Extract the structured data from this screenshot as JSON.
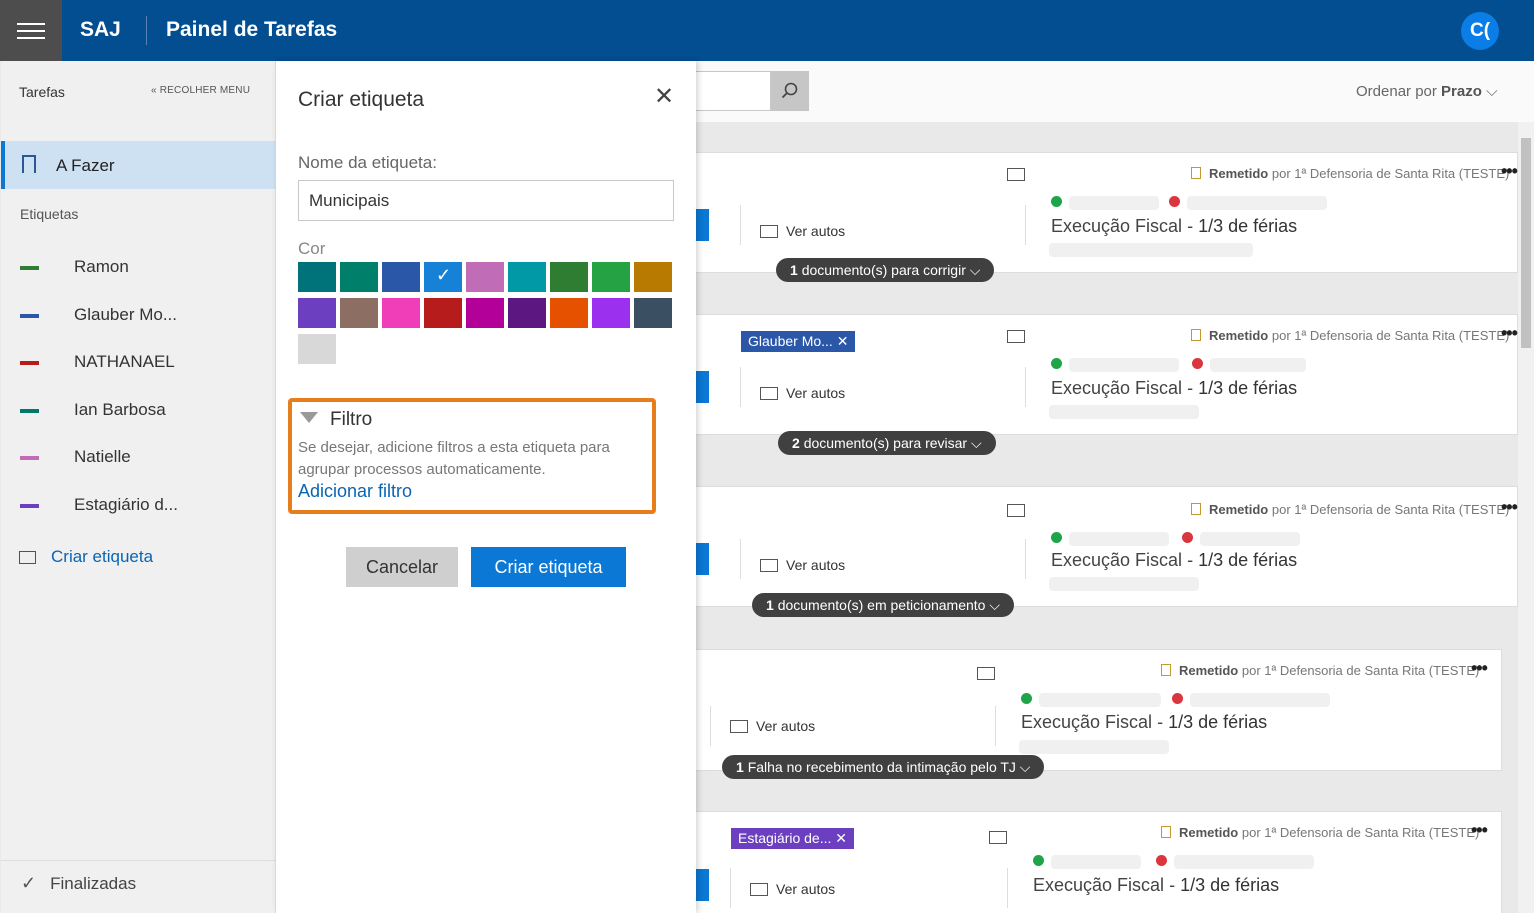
{
  "header": {
    "brand": "SAJ",
    "title": "Painel de Tarefas",
    "avatar": "C("
  },
  "sidebar": {
    "title": "Tarefas",
    "collapse": "RECOLHER MENU",
    "active_item": "A Fazer",
    "section": "Etiquetas",
    "tags": [
      {
        "label": "Ramon",
        "color": "#2e7d32"
      },
      {
        "label": "Glauber Mo...",
        "color": "#2b5797"
      },
      {
        "label": "NATHANAEL",
        "color": "#b71c1c"
      },
      {
        "label": "Ian Barbosa",
        "color": "#00796b"
      },
      {
        "label": "Natielle",
        "color": "#c36cb6"
      },
      {
        "label": "Estagiário d...",
        "color": "#6b3fc0"
      }
    ],
    "create_tag": "Criar etiqueta",
    "finalized": "Finalizadas"
  },
  "toolbar": {
    "order_label": "Ordenar por",
    "order_value": "Prazo"
  },
  "cards": [
    {
      "remetido": "Remetido",
      "by": "por 1ª Defensoria de Santa Rita (TESTE)",
      "ver_autos": "Ver autos",
      "exec": "Execução Fiscal",
      "exec_suffix": "1/3 de férias",
      "pill_count": "1",
      "pill_text": "documento(s) para corrigir",
      "tag": ""
    },
    {
      "remetido": "Remetido",
      "by": "por 1ª Defensoria de Santa Rita (TESTE)",
      "ver_autos": "Ver autos",
      "exec": "Execução Fiscal",
      "exec_suffix": "1/3 de férias",
      "pill_count": "2",
      "pill_text": "documento(s) para revisar",
      "tag": "Glauber Mo..."
    },
    {
      "remetido": "Remetido",
      "by": "por 1ª Defensoria de Santa Rita (TESTE)",
      "ver_autos": "Ver autos",
      "exec": "Execução Fiscal",
      "exec_suffix": "1/3 de férias",
      "pill_count": "1",
      "pill_text": "documento(s) em peticionamento",
      "tag": ""
    },
    {
      "remetido": "Remetido",
      "by": "por 1ª Defensoria de Santa Rita (TESTE)",
      "ver_autos": "Ver autos",
      "exec": "Execução Fiscal",
      "exec_suffix": "1/3 de férias",
      "pill_count": "1",
      "pill_text": "Falha no recebimento da intimação pelo TJ",
      "tag": ""
    },
    {
      "remetido": "Remetido",
      "by": "por 1ª Defensoria de Santa Rita (TESTE)",
      "ver_autos": "Ver autos",
      "exec": "Execução Fiscal",
      "exec_suffix": "1/3 de férias",
      "pill_count": "",
      "pill_text": "",
      "tag": "Estagiário de..."
    }
  ],
  "dialog": {
    "title": "Criar etiqueta",
    "name_label": "Nome da etiqueta:",
    "name_value": "Municipais",
    "color_label": "Cor",
    "colors": [
      "#00727a",
      "#00806b",
      "#2b57a8",
      "#1582d8",
      "#c06cb6",
      "#0099a5",
      "#2e7d32",
      "#25a244",
      "#b87a00",
      "#6b3fc0",
      "#8d6e63",
      "#f03db8",
      "#b71c1c",
      "#b30099",
      "#5c1780",
      "#e65100",
      "#9b30ef",
      "#3b4f63",
      "#d8d8d8"
    ],
    "selected_color": "#1582d8",
    "filter_title": "Filtro",
    "filter_desc": "Se desejar, adicione filtros a esta etiqueta para agrupar processos automaticamente.",
    "filter_link": "Adicionar filtro",
    "cancel": "Cancelar",
    "create": "Criar etiqueta"
  }
}
